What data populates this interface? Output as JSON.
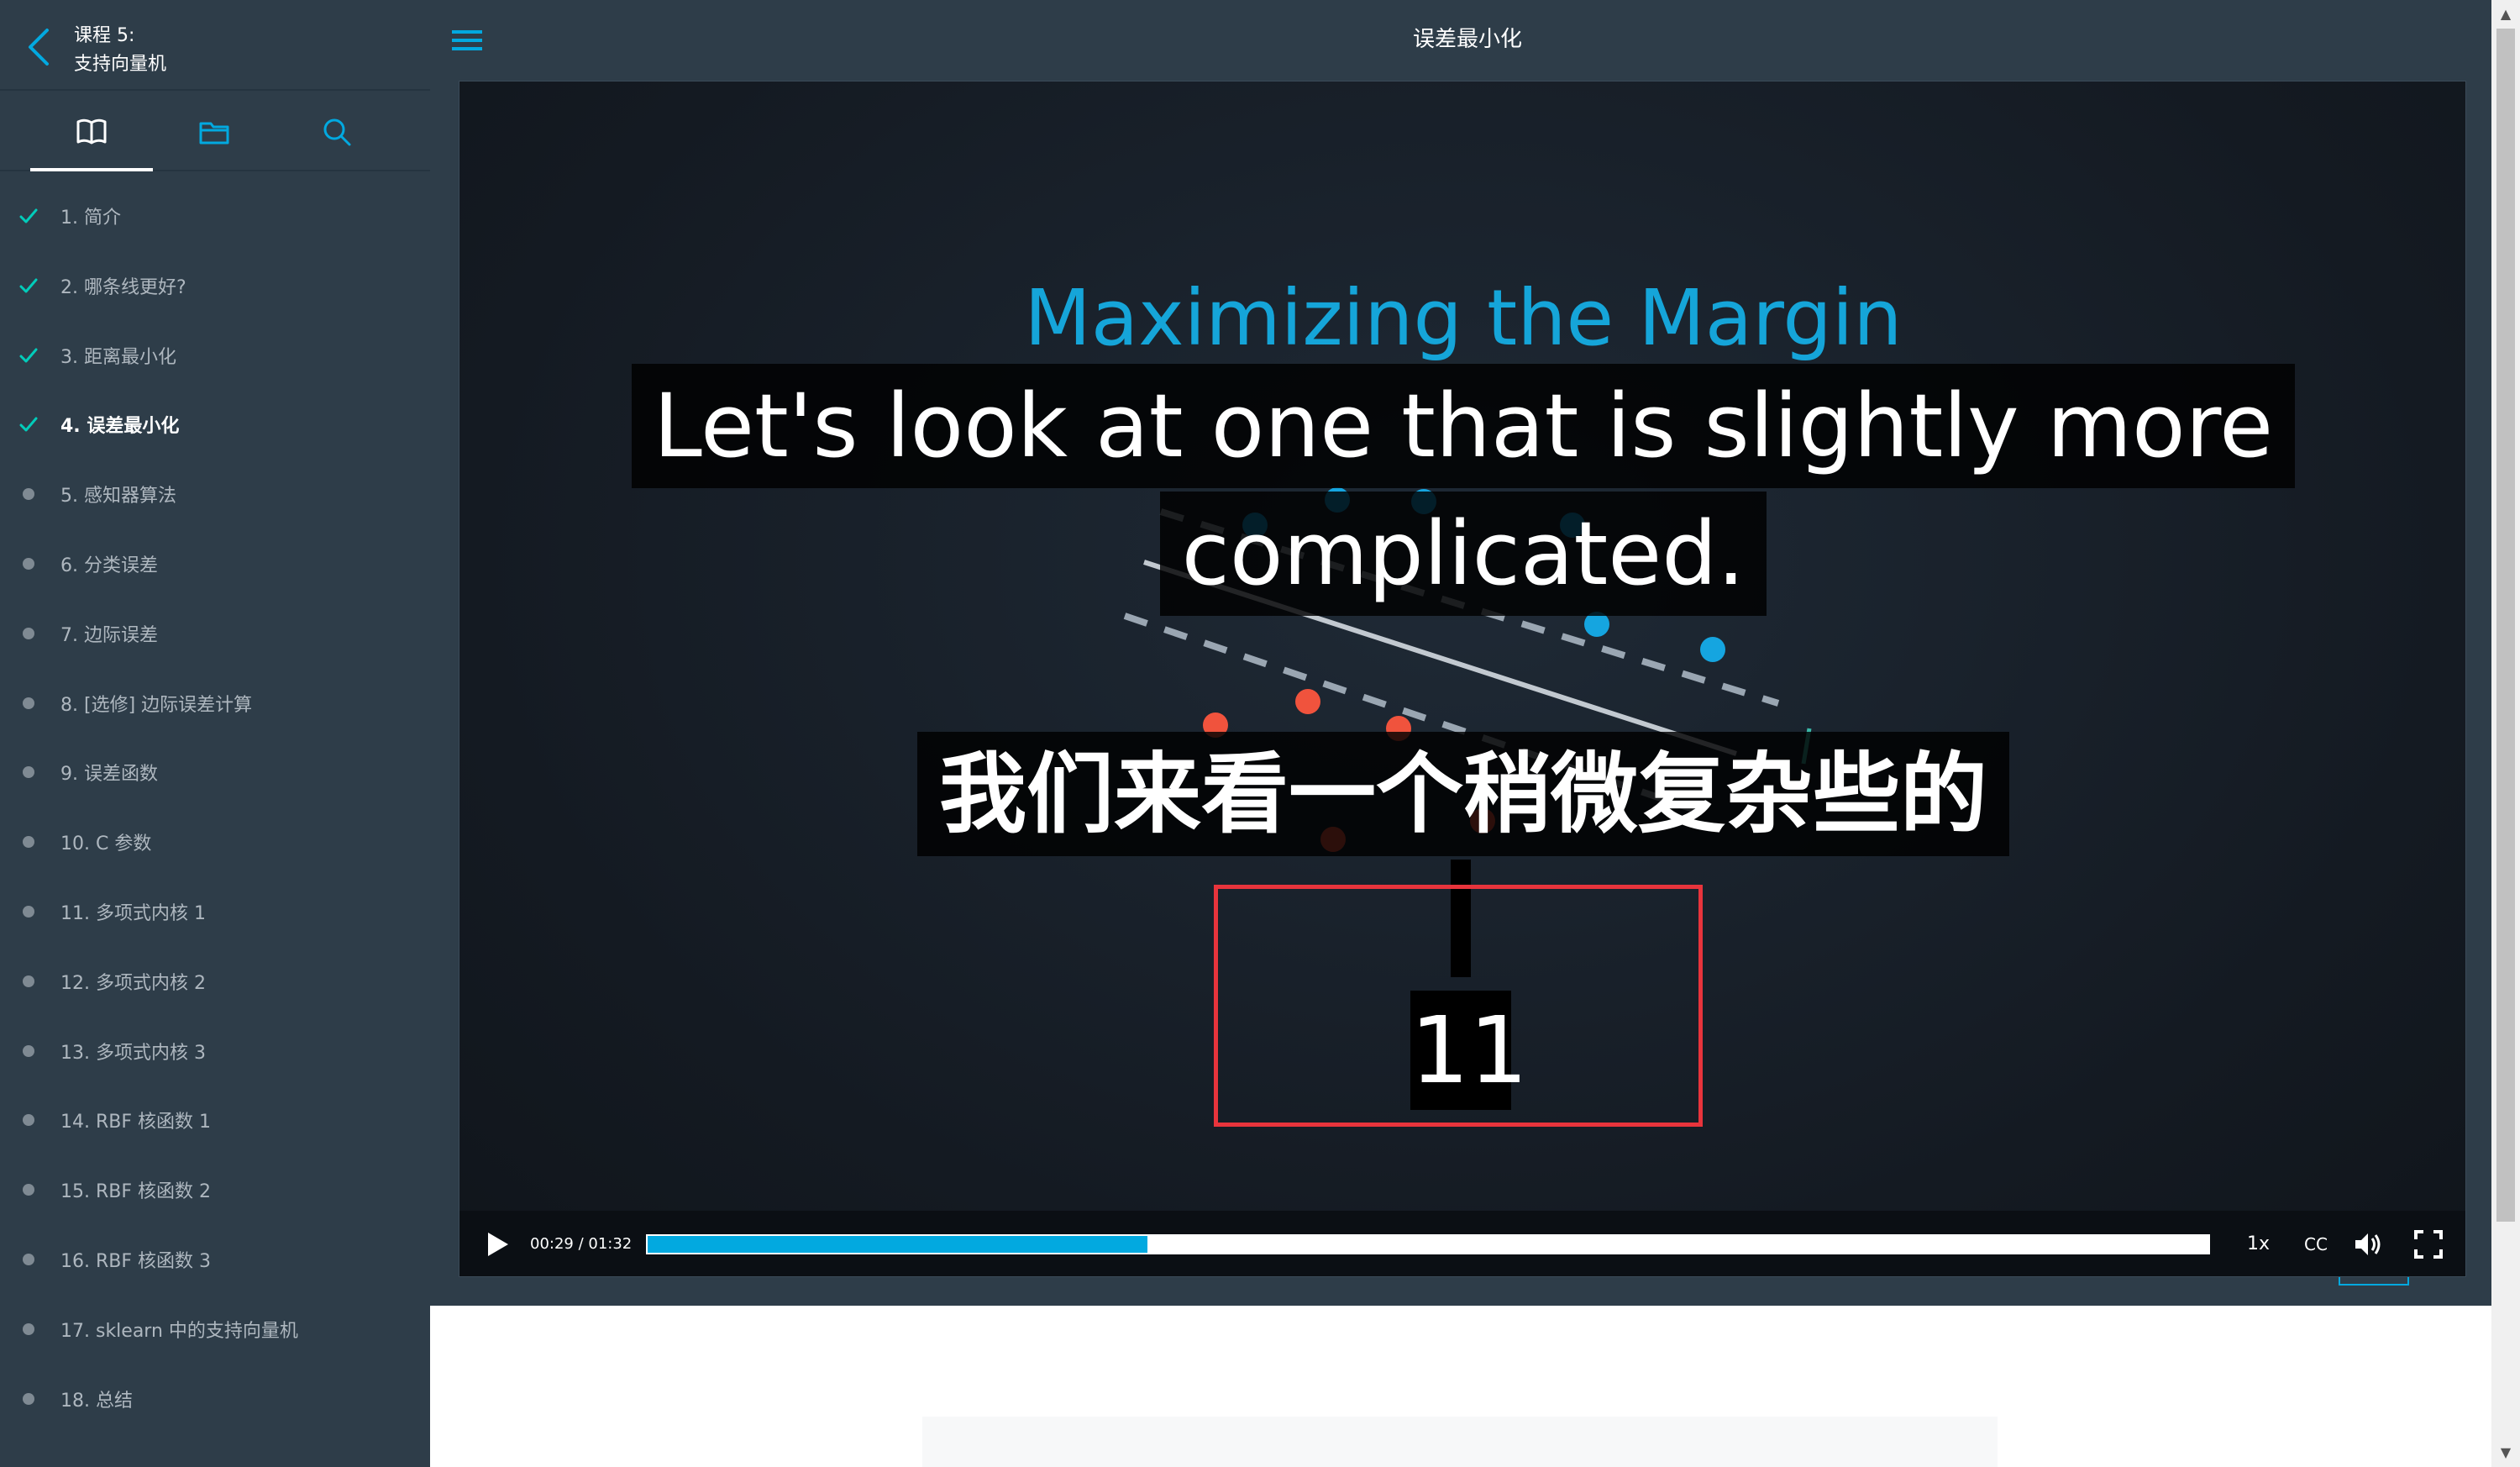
{
  "sidebar": {
    "course_line1": "课程 5:",
    "course_line2": "支持向量机",
    "tabs": [
      "lessons",
      "resources",
      "search"
    ],
    "lessons": [
      {
        "label": "1. 简介",
        "status": "done"
      },
      {
        "label": "2. 哪条线更好?",
        "status": "done"
      },
      {
        "label": "3. 距离最小化",
        "status": "done"
      },
      {
        "label": "4. 误差最小化",
        "status": "current"
      },
      {
        "label": "5. 感知器算法",
        "status": "todo"
      },
      {
        "label": "6. 分类误差",
        "status": "todo"
      },
      {
        "label": "7. 边际误差",
        "status": "todo"
      },
      {
        "label": "8. [选修] 边际误差计算",
        "status": "todo"
      },
      {
        "label": "9. 误差函数",
        "status": "todo"
      },
      {
        "label": "10. C 参数",
        "status": "todo"
      },
      {
        "label": "11. 多项式内核 1",
        "status": "todo"
      },
      {
        "label": "12. 多项式内核 2",
        "status": "todo"
      },
      {
        "label": "13. 多项式内核 3",
        "status": "todo"
      },
      {
        "label": "14. RBF 核函数 1",
        "status": "todo"
      },
      {
        "label": "15. RBF 核函数 2",
        "status": "todo"
      },
      {
        "label": "16. RBF 核函数 3",
        "status": "todo"
      },
      {
        "label": "17. sklearn 中的支持向量机",
        "status": "todo"
      },
      {
        "label": "18. 总结",
        "status": "todo"
      }
    ]
  },
  "header": {
    "title": "误差最小化"
  },
  "video": {
    "slide_title": "Maximizing the Margin",
    "caption_en_line1": "Let's look at one that is slightly more",
    "caption_en_line2": "complicated.",
    "caption_zh": "我们来看一个稍微复杂些的",
    "caption_number": "11",
    "time": "00:29 / 01:32",
    "progress": 0.32,
    "speed": "1x",
    "cc_label": "CC"
  },
  "colors": {
    "sidebar_bg": "#2e3d49",
    "accent": "#02a9e0",
    "check": "#02ccba",
    "highlight_box": "#e8343c",
    "slide_title": "#15a5d9"
  }
}
